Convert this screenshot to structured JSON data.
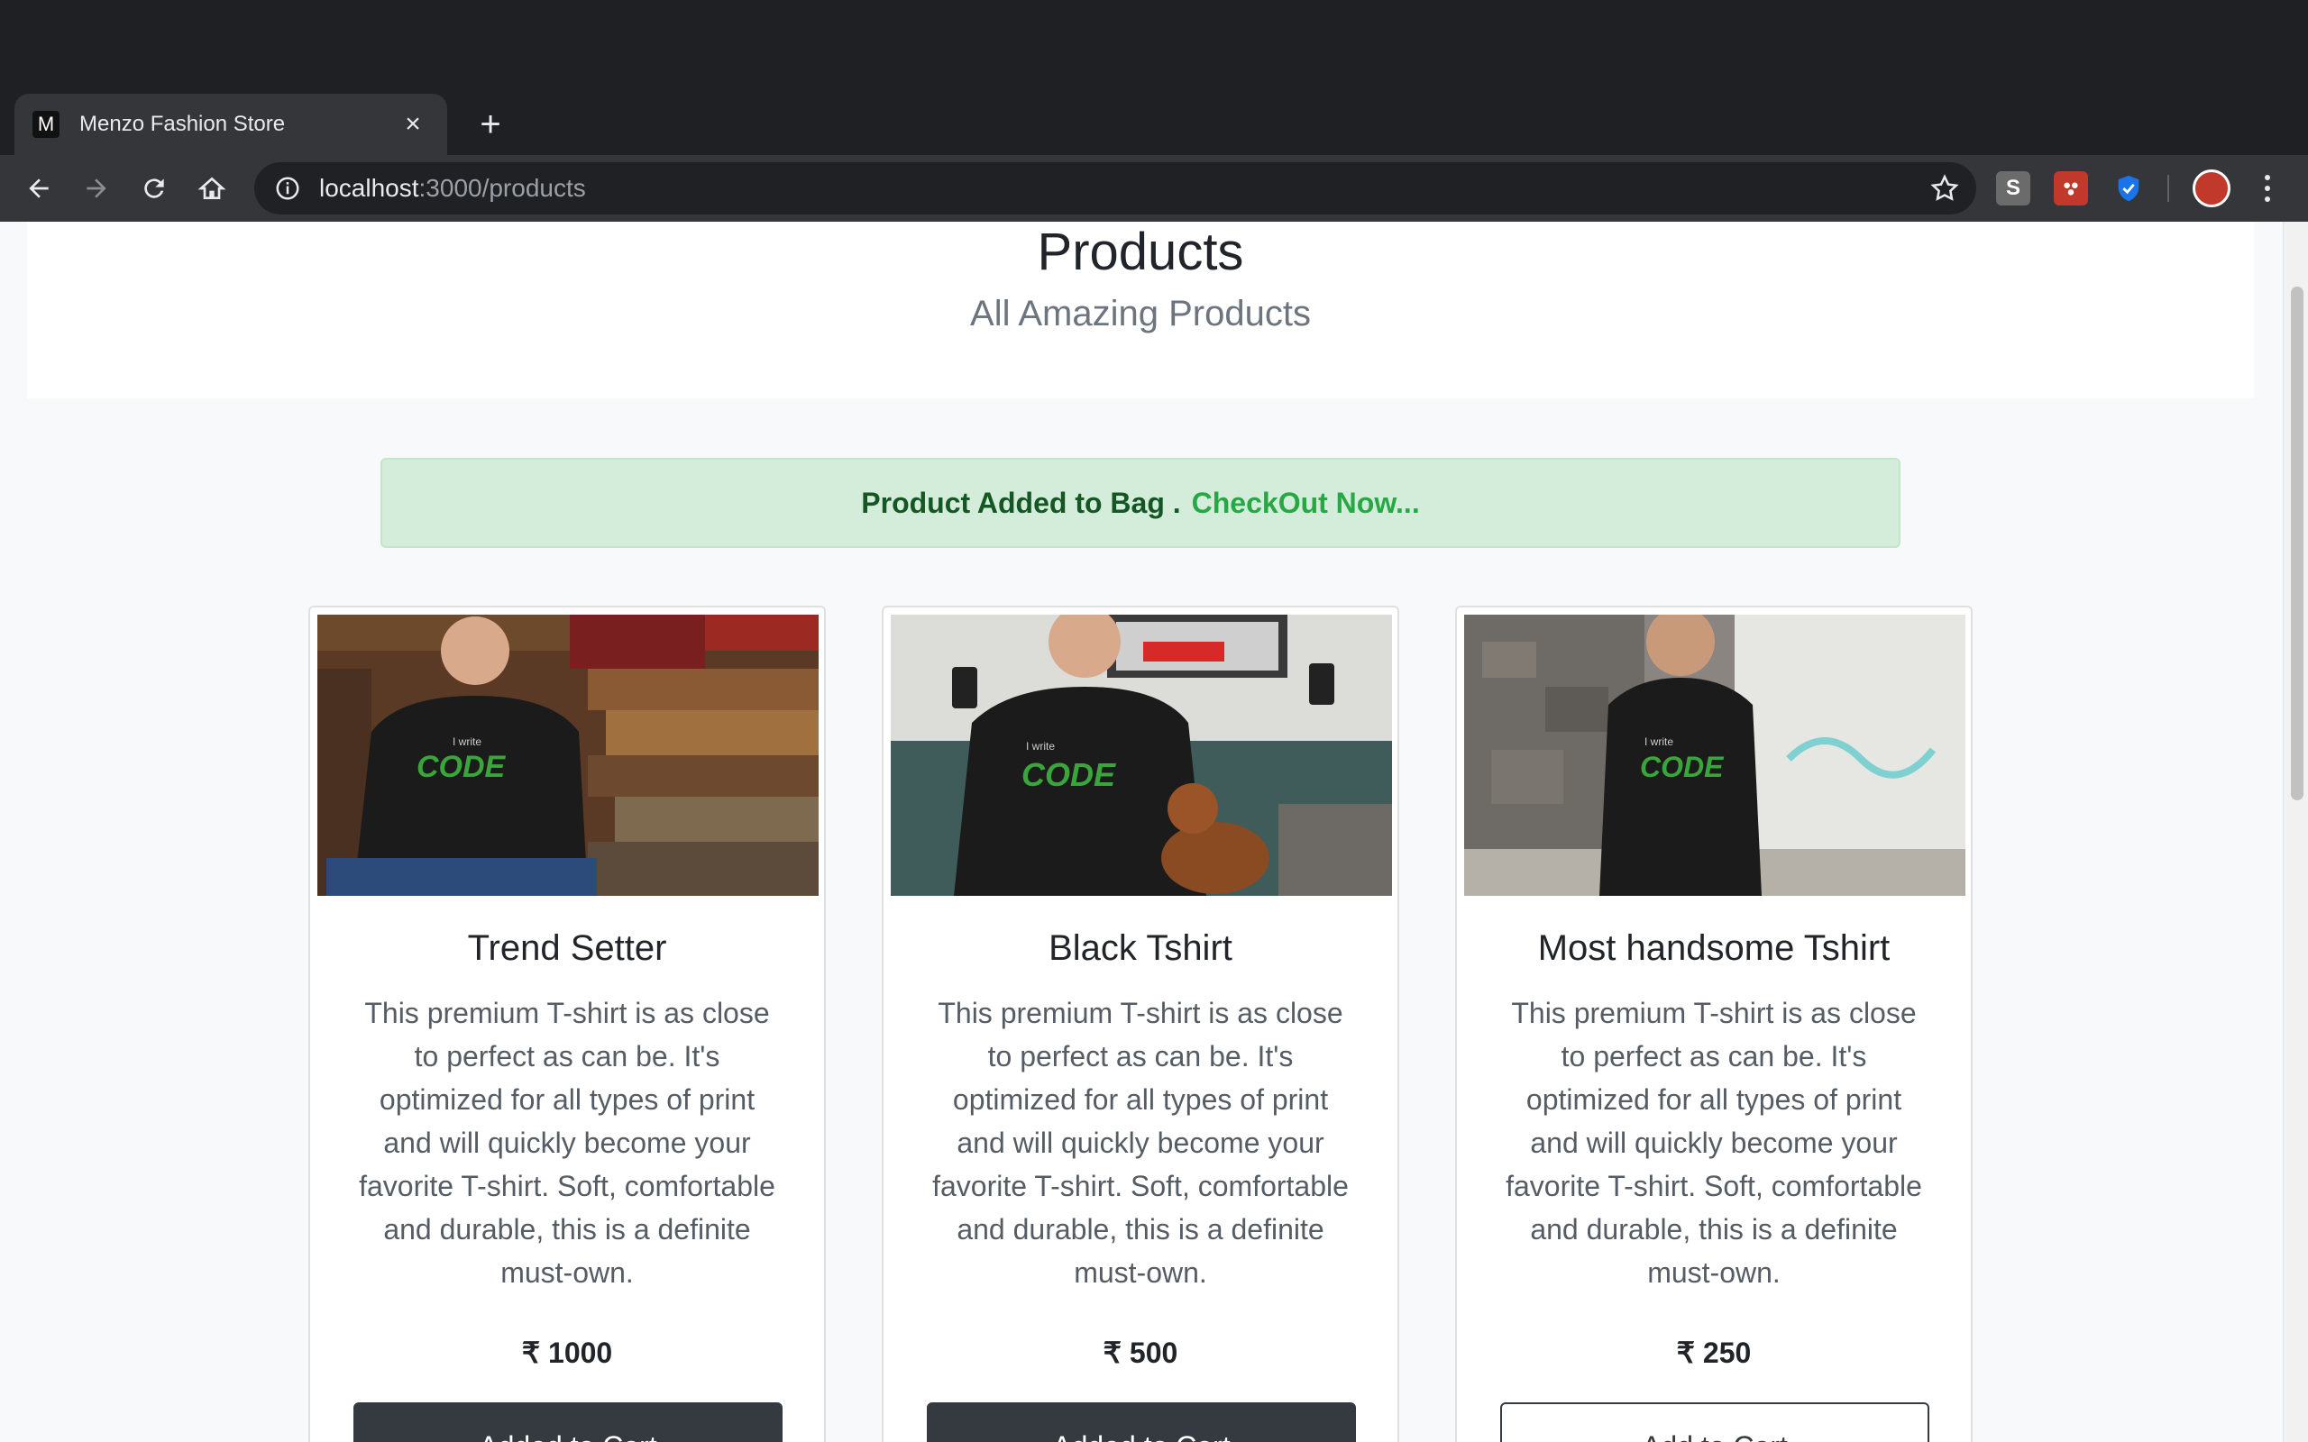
{
  "browser": {
    "tab_title": "Menzo Fashion Store",
    "favicon_letter": "M",
    "url_host": "localhost",
    "url_path": ":3000/products"
  },
  "page": {
    "title": "Products",
    "subtitle": "All Amazing Products"
  },
  "alert": {
    "message": "Product Added to Bag .",
    "link": "CheckOut Now..."
  },
  "products": [
    {
      "name": "Trend Setter",
      "description": "This premium T-shirt is as close to perfect as can be. It's optimized for all types of print and will quickly become your favorite T-shirt. Soft, comfortable and durable, this is a definite must-own.",
      "price": "₹ 1000",
      "button": "Added to Cart",
      "button_state": "added"
    },
    {
      "name": "Black Tshirt",
      "description": "This premium T-shirt is as close to perfect as can be. It's optimized for all types of print and will quickly become your favorite T-shirt. Soft, comfortable and durable, this is a definite must-own.",
      "price": "₹ 500",
      "button": "Added to Cart",
      "button_state": "added"
    },
    {
      "name": "Most handsome Tshirt",
      "description": "This premium T-shirt is as close to perfect as can be. It's optimized for all types of print and will quickly become your favorite T-shirt. Soft, comfortable and durable, this is a definite must-own.",
      "price": "₹ 250",
      "button": "Add to Cart",
      "button_state": "default"
    }
  ],
  "colors": {
    "alert_bg": "#d4edda",
    "alert_text": "#155724",
    "alert_link": "#28a745",
    "button_dark": "#343a40"
  }
}
